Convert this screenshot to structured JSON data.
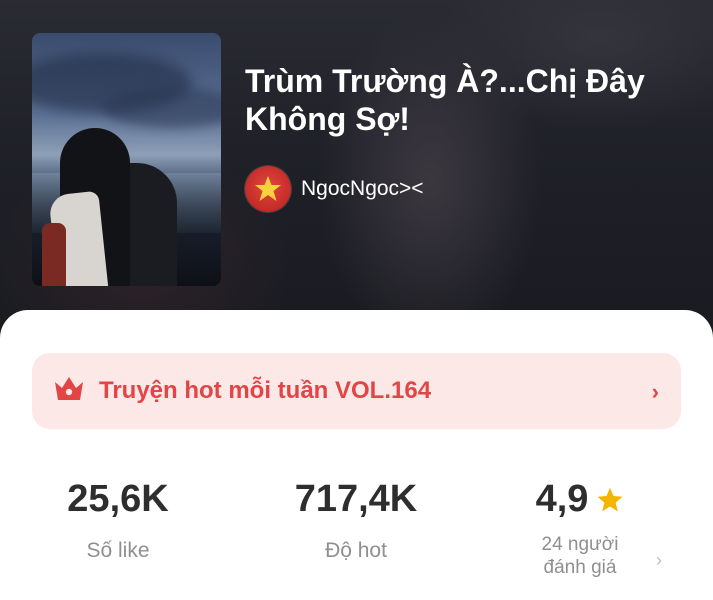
{
  "story": {
    "title": "Trùm Trường À?...Chị Đây Không Sợ!",
    "author": "NgocNgoc><",
    "cover_image": "cover-photo"
  },
  "banner": {
    "label": "Truyện hot mỗi tuần VOL.164",
    "icon": "crown-icon",
    "chevron": "›",
    "accent": "#e24545",
    "background": "#fde8e8"
  },
  "stats": {
    "likes": {
      "value": "25,6K",
      "label": "Số like"
    },
    "hot": {
      "value": "717,4K",
      "label": "Độ hot"
    },
    "rating": {
      "value": "4,9",
      "label_line1": "24 người",
      "label_line2": "đánh giá",
      "icon": "star-icon",
      "chevron": "›"
    }
  },
  "colors": {
    "accent": "#e24545",
    "star": "#f5b400",
    "text_dark": "#2e2e2e",
    "text_muted": "#8f8f8f"
  }
}
